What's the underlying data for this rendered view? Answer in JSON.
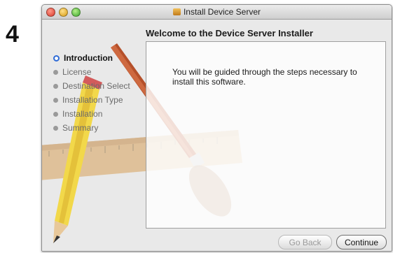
{
  "step_number": "4",
  "window": {
    "title": "Install Device Server",
    "heading": "Welcome to the Device Server Installer",
    "message": "You will be guided through the steps necessary to install this software."
  },
  "sidebar": {
    "steps": [
      {
        "label": "Introduction",
        "active": true
      },
      {
        "label": "License",
        "active": false
      },
      {
        "label": "Destination Select",
        "active": false
      },
      {
        "label": "Installation Type",
        "active": false
      },
      {
        "label": "Installation",
        "active": false
      },
      {
        "label": "Summary",
        "active": false
      }
    ]
  },
  "buttons": {
    "back_label": "Go Back",
    "continue_label": "Continue"
  },
  "colors": {
    "active_step_ring": "#2f6bd6",
    "close_light": "#d9382a",
    "minimize_light": "#d69a12",
    "zoom_light": "#3aa52a"
  },
  "icons": [
    "close-icon",
    "minimize-icon",
    "zoom-icon",
    "package-icon",
    "pencil-illustration",
    "brush-illustration",
    "ruler-illustration"
  ]
}
